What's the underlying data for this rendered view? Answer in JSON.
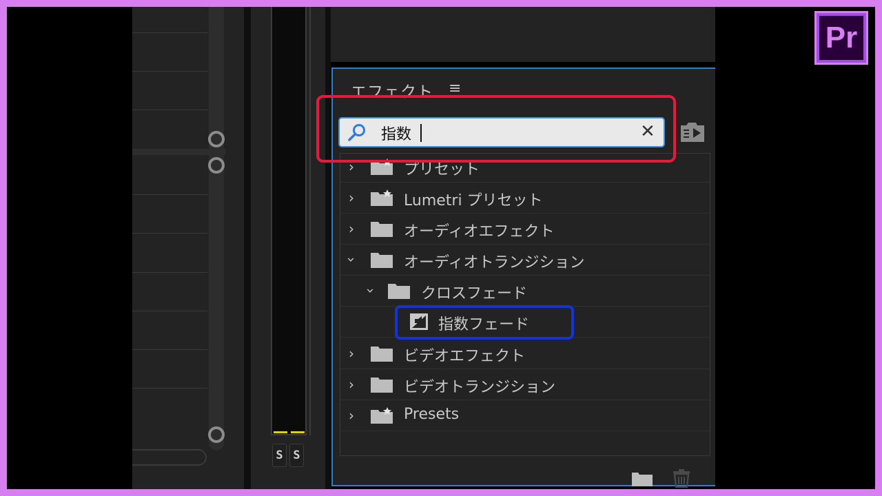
{
  "effects_panel": {
    "title": "エフェクト",
    "menu_icon": "hamburger-icon",
    "search": {
      "value": "指数",
      "icon": "search-icon",
      "clear_icon": "close-icon"
    },
    "items": [
      {
        "label": "プリセット",
        "expanded": false,
        "icon": "folder-star-icon"
      },
      {
        "label": "Lumetri プリセット",
        "expanded": false,
        "icon": "folder-star-icon"
      },
      {
        "label": "オーディオエフェクト",
        "expanded": false,
        "icon": "folder-icon"
      },
      {
        "label": "オーディオトランジション",
        "expanded": true,
        "icon": "folder-icon"
      },
      {
        "label": "クロスフェード",
        "expanded": true,
        "icon": "folder-icon"
      },
      {
        "label": "指数フェード",
        "icon": "audio-transition-icon"
      },
      {
        "label": "ビデオエフェクト",
        "expanded": false,
        "icon": "folder-icon"
      },
      {
        "label": "ビデオトランジション",
        "expanded": false,
        "icon": "folder-icon"
      },
      {
        "label": "Presets",
        "expanded": false,
        "icon": "folder-star-icon"
      }
    ]
  },
  "meter": {
    "solo_labels": [
      "S",
      "S"
    ]
  },
  "logo": {
    "text": "Pr"
  },
  "colors": {
    "highlight_red": "#e8193c",
    "highlight_blue": "#1633d9",
    "panel_focus": "#2d7fd4",
    "frame": "#d77ff0"
  }
}
